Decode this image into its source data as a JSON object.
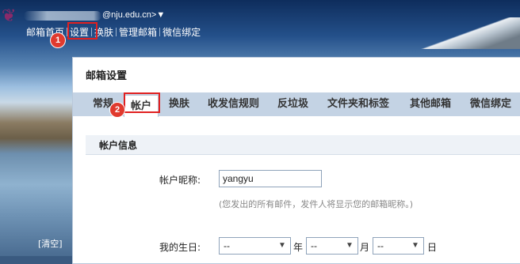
{
  "header": {
    "email_domain": "@nju.edu.cn>▼",
    "nav": [
      "邮箱首页",
      "设置",
      "换肤",
      "管理邮箱",
      "微信绑定"
    ],
    "clear_link": "[清空]"
  },
  "annotations": {
    "badge1": "1",
    "badge2": "2"
  },
  "panel": {
    "title": "邮箱设置",
    "tabs": [
      "常规",
      "帐户",
      "换肤",
      "收发信规则",
      "反垃圾",
      "文件夹和标签",
      "其他邮箱",
      "微信绑定"
    ],
    "active_tab": "帐户",
    "section_title": "帐户信息",
    "nickname_label": "帐户昵称:",
    "nickname_value": "yangyu",
    "nickname_hint": "(您发出的所有邮件，发件人将显示您的邮箱昵称。)",
    "birthday_label": "我的生日:",
    "birthday_year": "--",
    "birthday_month": "--",
    "birthday_day": "--",
    "unit_year": "年",
    "unit_month": "月",
    "unit_day": "日"
  },
  "colors": {
    "accent_red": "#e02020",
    "tab_bar": "#c4d3e4"
  }
}
